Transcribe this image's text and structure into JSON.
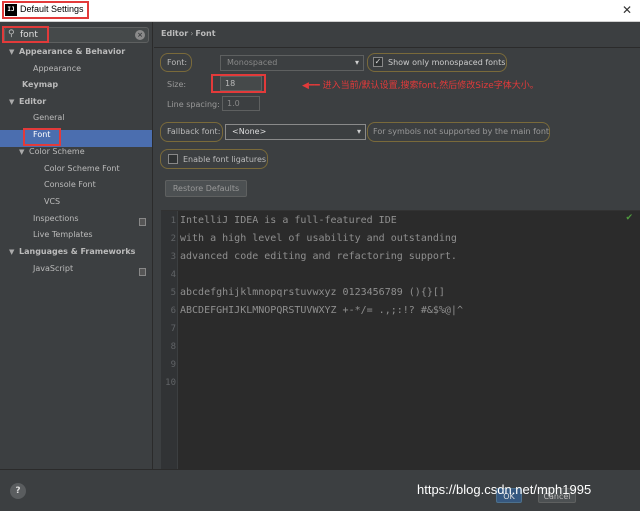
{
  "window": {
    "app_icon": "IJ",
    "title": "Default Settings",
    "close_glyph": "✕"
  },
  "sidebar": {
    "search_value": "font",
    "search_icon": "search-icon",
    "items": [
      {
        "label": "Appearance & Behavior",
        "arrow": "▼",
        "level": 0,
        "bold": true
      },
      {
        "label": "Appearance",
        "level": 2
      },
      {
        "label": "Keymap",
        "level": 0,
        "bold": true
      },
      {
        "label": "Editor",
        "arrow": "▼",
        "level": 0,
        "bold": true
      },
      {
        "label": "General",
        "level": 2
      },
      {
        "label": "Font",
        "level": 2,
        "selected": true
      },
      {
        "label": "Color Scheme",
        "arrow": "▼",
        "level": 1
      },
      {
        "label": "Color Scheme Font",
        "level": 3
      },
      {
        "label": "Console Font",
        "level": 3
      },
      {
        "label": "VCS",
        "level": 3
      },
      {
        "label": "Inspections",
        "level": 2
      },
      {
        "label": "Live Templates",
        "level": 2
      },
      {
        "label": "Languages & Frameworks",
        "arrow": "▼",
        "level": 0,
        "bold": true
      },
      {
        "label": "JavaScript",
        "level": 2
      }
    ],
    "help_glyph": "?"
  },
  "main": {
    "breadcrumb": {
      "part1": "Editor",
      "sep": "›",
      "part2": "Font"
    },
    "font_label": "Font:",
    "font_value": "Monospaced",
    "show_monospaced_label": "Show only monospaced fonts",
    "show_monospaced_checked": true,
    "size_label": "Size:",
    "size_value": "18",
    "line_spacing_label": "Line spacing:",
    "line_spacing_value": "1.0",
    "fallback_label": "Fallback font:",
    "fallback_value": "<None>",
    "fallback_hint": "For symbols not supported by the main font",
    "ligatures_label": "Enable font ligatures",
    "ligatures_checked": false,
    "restore_label": "Restore Defaults",
    "annotation": "进入当前/默认设置,搜索font,然后修改Size字体大小。",
    "annotation_arrow": "◀━━"
  },
  "preview": {
    "line_numbers": [
      "1",
      "2",
      "3",
      "4",
      "5",
      "6",
      "7",
      "8",
      "9",
      "10"
    ],
    "lines": [
      "IntelliJ IDEA is a full-featured IDE",
      "with a high level of usability and outstanding",
      "advanced code editing and refactoring support.",
      "",
      "abcdefghijklmnopqrstuvwxyz 0123456789 (){}[]",
      "ABCDEFGHIJKLMNOPQRSTUVWXYZ +-*/= .,;:!? #&$%@|^",
      "",
      "",
      "",
      ""
    ],
    "status_glyph": "✔"
  },
  "footer": {
    "ok_label": "OK",
    "cancel_label": "Cancel",
    "watermark": "https://blog.csdn.net/mph1995"
  },
  "colors": {
    "highlight": "#e23a3a",
    "selection": "#4b6eaf",
    "background": "#3c3f41",
    "editor_background": "#2b2b2b"
  }
}
